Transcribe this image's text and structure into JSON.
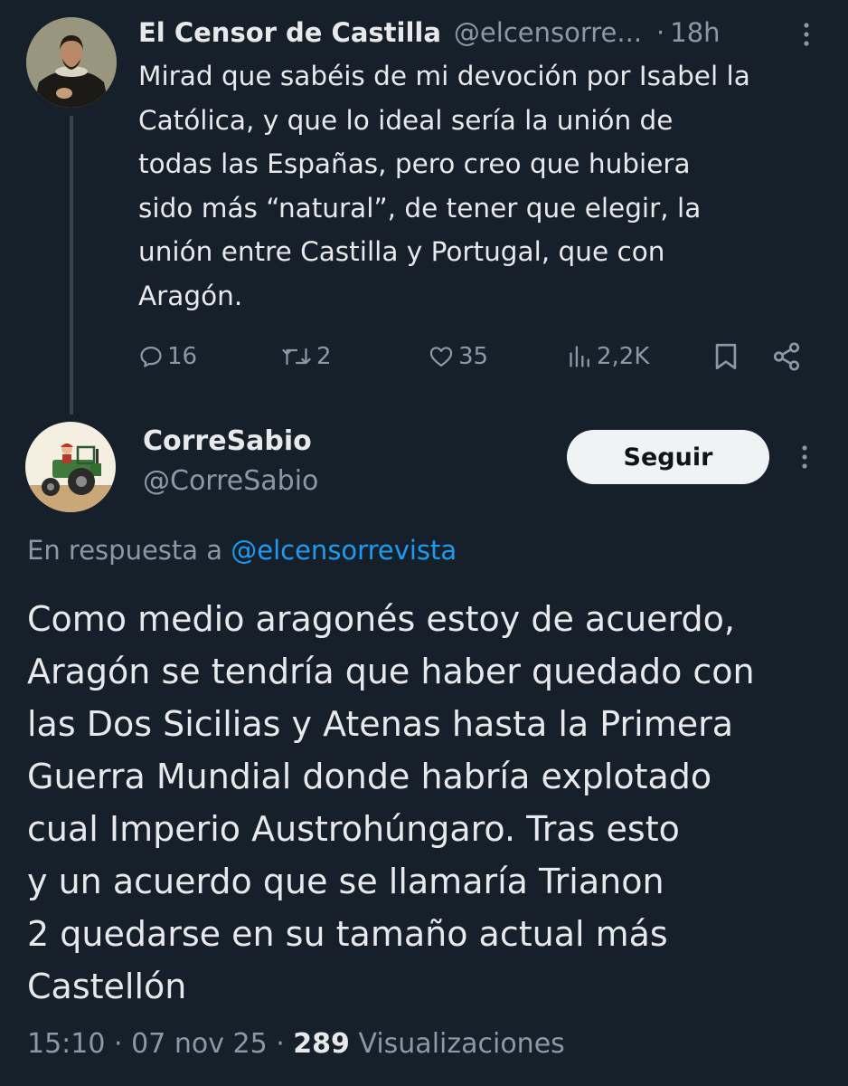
{
  "colors": {
    "background": "#15202b",
    "text_primary": "#e7e9ea",
    "text_secondary": "#8b98a5",
    "link": "#1d9bf0",
    "thread_line": "#38444d",
    "follow_button_bg": "#eff3f4"
  },
  "parent_tweet": {
    "author_name": "El Censor de Castilla",
    "author_handle": "@elcensorre...",
    "separator": "·",
    "time": "18h",
    "text": "Mirad que sabéis de mi devoción por Isabel la\nCatólica, y que lo ideal sería la unión de\ntodas las Españas, pero creo que hubiera\nsido más “natural”, de tener que elegir, la\nunión entre Castilla y Portugal, que con\nAragón.",
    "avatar_icon": "portrait-painting-avatar",
    "actions": {
      "replies": "16",
      "retweets": "2",
      "likes": "35",
      "views": "2,2K"
    }
  },
  "reply_tweet": {
    "author_name": "CorreSabio",
    "author_handle": "@CorreSabio",
    "avatar_icon": "tractor-avatar",
    "follow_label": "Seguir",
    "reply_prefix": "En respuesta a",
    "reply_mention": "@elcensorrevista",
    "text": "Como medio aragonés estoy de acuerdo,\nAragón se tendría que haber quedado con\nlas Dos Sicilias y Atenas hasta la Primera\nGuerra Mundial donde habría explotado\ncual Imperio Austrohúngaro. Tras esto\ny un acuerdo que se llamaría Trianon\n2 quedarse en su tamaño actual más\nCastellón",
    "time": "15:10",
    "date": "07 nov 25",
    "separator": "·",
    "views_count": "289",
    "views_label": "Visualizaciones"
  }
}
